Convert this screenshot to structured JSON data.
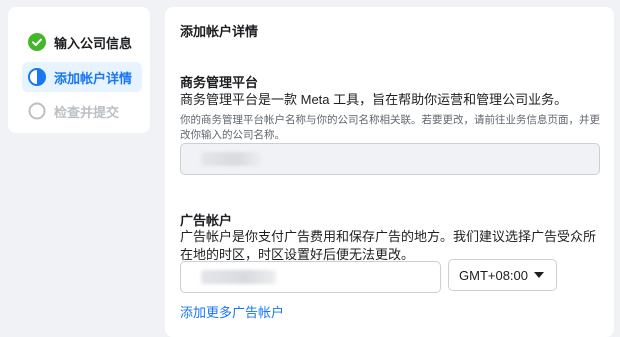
{
  "steps": [
    {
      "label": "输入公司信息",
      "state": "done",
      "icon": "check-circle-icon"
    },
    {
      "label": "添加帐户详情",
      "state": "current",
      "icon": "half-circle-icon"
    },
    {
      "label": "检查并提交",
      "state": "pending",
      "icon": "empty-circle-icon"
    }
  ],
  "main": {
    "title": "添加帐户详情",
    "business_manager": {
      "heading": "商务管理平台",
      "description": "商务管理平台是一款 Meta 工具，旨在帮助你运营和管理公司业务。",
      "note": "你的商务管理平台帐户名称与你的公司名称相关联。若要更改，请前往业务信息页面，并更改你输入的公司名称。"
    },
    "ad_account": {
      "heading": "广告帐户",
      "description": "广告帐户是你支付广告费用和保存广告的地方。我们建议选择广告受众所在地的时区，时区设置好后便无法更改。",
      "timezone": "GMT+08:00",
      "add_link": "添加更多广告帐户"
    }
  },
  "colors": {
    "accent": "#1877f2",
    "success": "#42b72a",
    "disabled": "#bcc0c4"
  }
}
